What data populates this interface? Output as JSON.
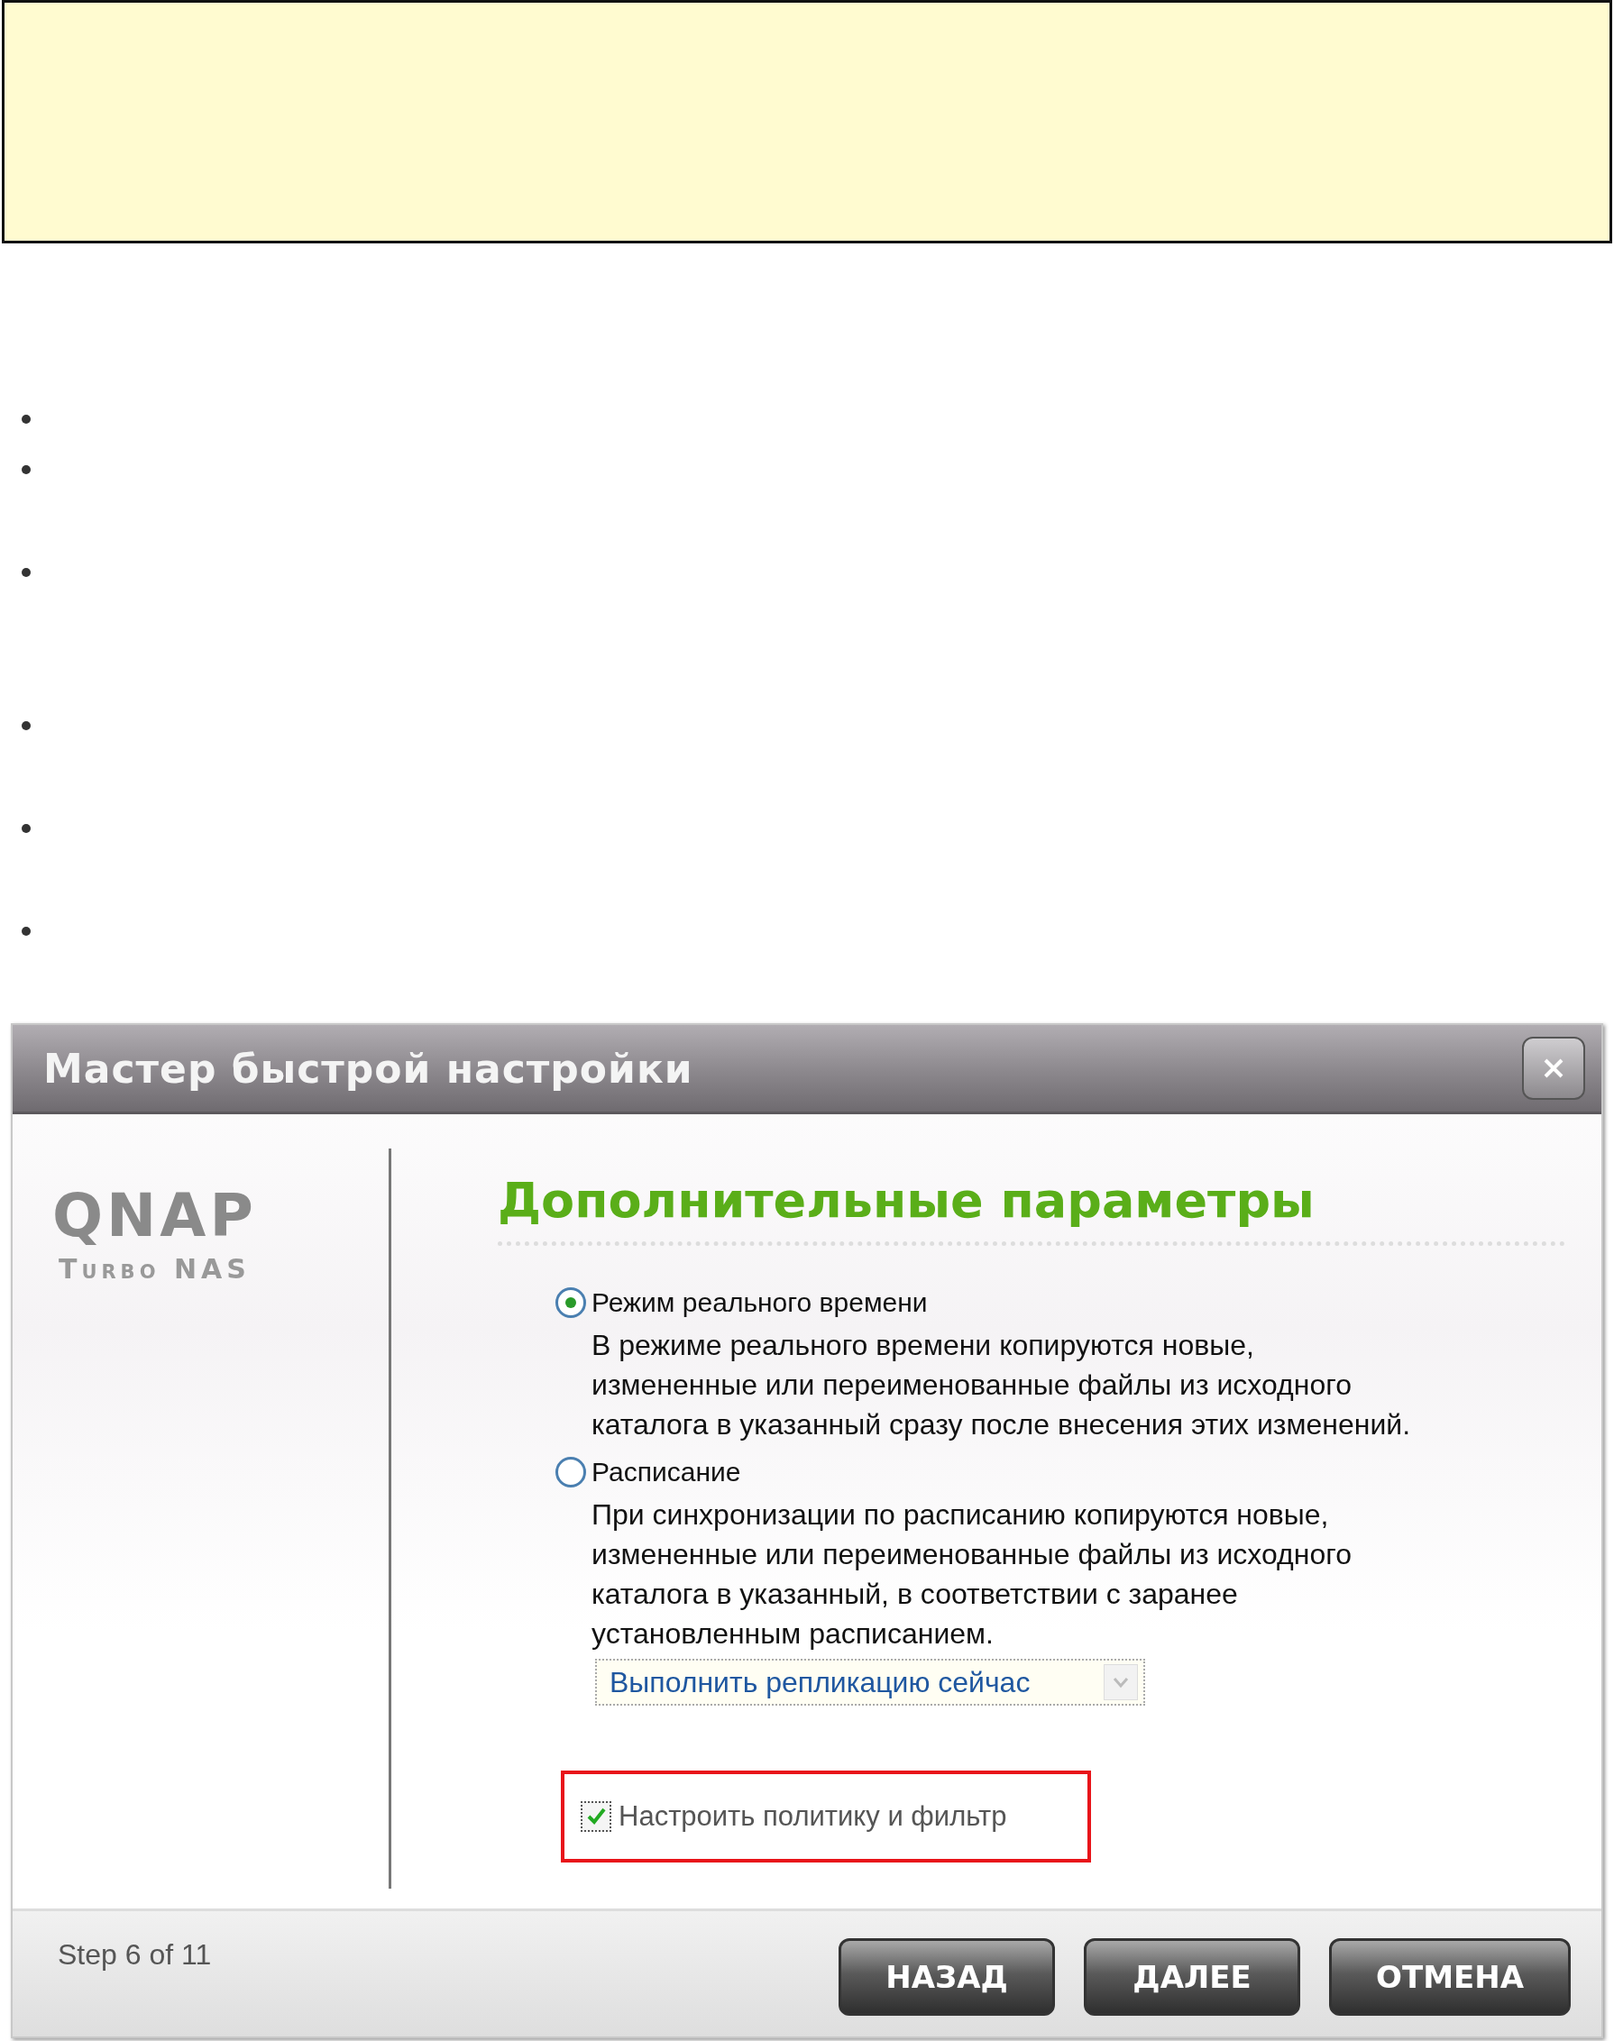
{
  "note_box": {
    "kind": "empty"
  },
  "bullets": [
    {
      "kind": "dot"
    },
    {
      "kind": "dot"
    },
    {
      "kind": "dot"
    },
    {
      "kind": "dot"
    },
    {
      "kind": "dot"
    },
    {
      "kind": "dot"
    }
  ],
  "dialog": {
    "title": "Мастер быстрой настройки",
    "logo": {
      "brand": "QNAP",
      "product": "Turbo NAS"
    },
    "heading": "Дополнительные параметры",
    "options": [
      {
        "label": "Режим реального времени",
        "selected": true,
        "description": [
          "В режиме реального времени копируются новые,",
          "измененные или переименованные файлы из исходного",
          "каталога в указанный сразу после внесения этих изменений."
        ]
      },
      {
        "label": "Расписание",
        "selected": false,
        "description": [
          "При синхронизации по расписанию копируются новые,",
          "измененные или переименованные файлы из исходного",
          "каталога в указанный, в соответствии с заранее",
          "установленным расписанием."
        ]
      }
    ],
    "schedule_dropdown": {
      "value": "Выполнить репликацию сейчас"
    },
    "policy_checkbox": {
      "label": "Настроить политику и фильтр",
      "checked": true,
      "highlighted": true
    },
    "step": "Step 6 of 11",
    "buttons": [
      "НАЗАД",
      "ДАЛЕЕ",
      "ОТМЕНА"
    ]
  }
}
